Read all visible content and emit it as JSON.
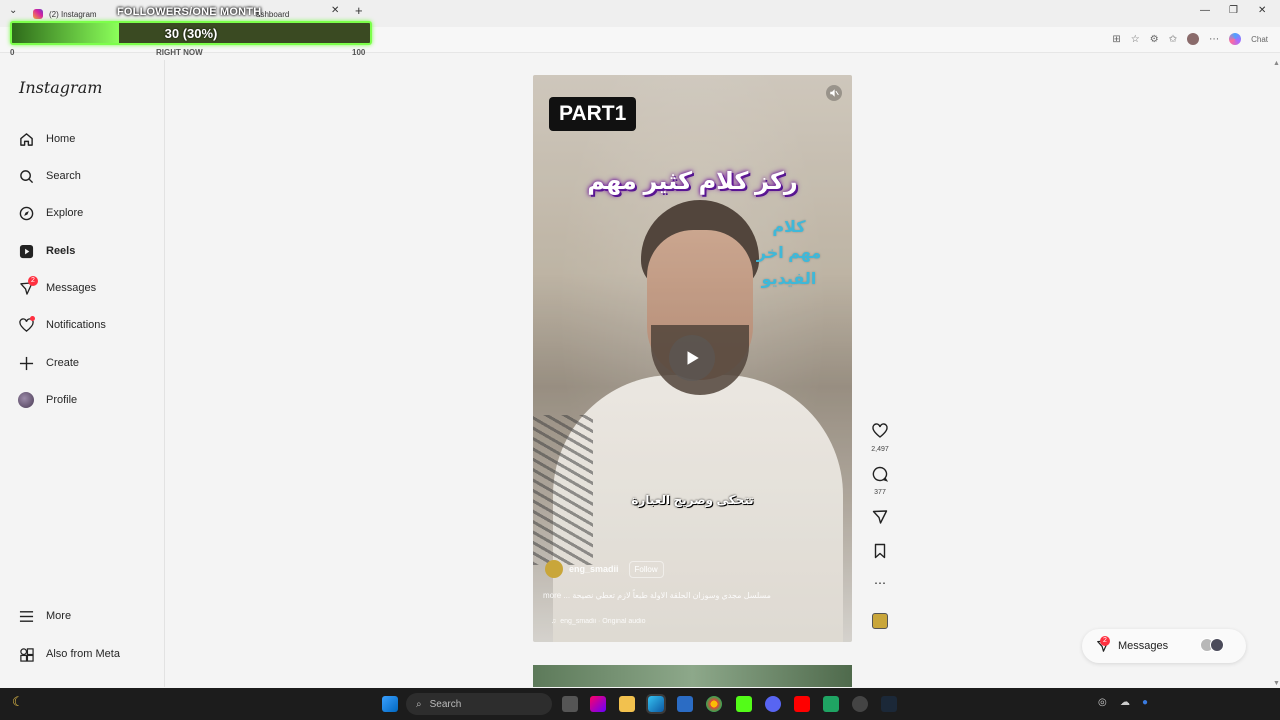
{
  "browser": {
    "tabs": [
      {
        "label": "(2) Instagram"
      },
      {
        "label": "ashboard"
      }
    ],
    "chat_label": "Chat"
  },
  "overlay": {
    "title": "FOLLOWERS/ONE MONTH",
    "value_text": "30 (30%)",
    "progress_fraction": 0.3,
    "min_label": "0",
    "mid_label": "RIGHT NOW",
    "max_label": "100"
  },
  "sidebar": {
    "logo": "Instagram",
    "items": [
      {
        "label": "Home",
        "icon": "home-icon"
      },
      {
        "label": "Search",
        "icon": "search-icon"
      },
      {
        "label": "Explore",
        "icon": "compass-icon"
      },
      {
        "label": "Reels",
        "icon": "reels-icon"
      },
      {
        "label": "Messages",
        "icon": "messenger-icon",
        "badge": "2"
      },
      {
        "label": "Notifications",
        "icon": "heart-icon"
      },
      {
        "label": "Create",
        "icon": "plus-icon"
      },
      {
        "label": "Profile",
        "icon": "avatar"
      }
    ],
    "more": "More",
    "also_from_meta": "Also from Meta"
  },
  "reel": {
    "part_badge": "PART1",
    "overlay_title": "ركز كلام كثير مهم",
    "overlay_side": "كلام مهم اخر الفيديو",
    "subtitle": "تتحكى وصريح العبارة",
    "author": "eng_smadii",
    "follow_label": "Follow",
    "caption": "مسلسل مجدي وسوزان الحلقة الاولة طبعاً لازم تعطي نصيحة ... more",
    "audio": "eng_smadii · Original audio"
  },
  "actions": {
    "likes": "2,497",
    "comments": "377"
  },
  "messages_pill": {
    "label": "Messages",
    "badge": "2"
  },
  "taskbar": {
    "search_placeholder": "Search"
  },
  "colors": {
    "progress_border": "#7cff4a",
    "badge_red": "#ff3040",
    "arabic_side": "#3fb8d8"
  }
}
